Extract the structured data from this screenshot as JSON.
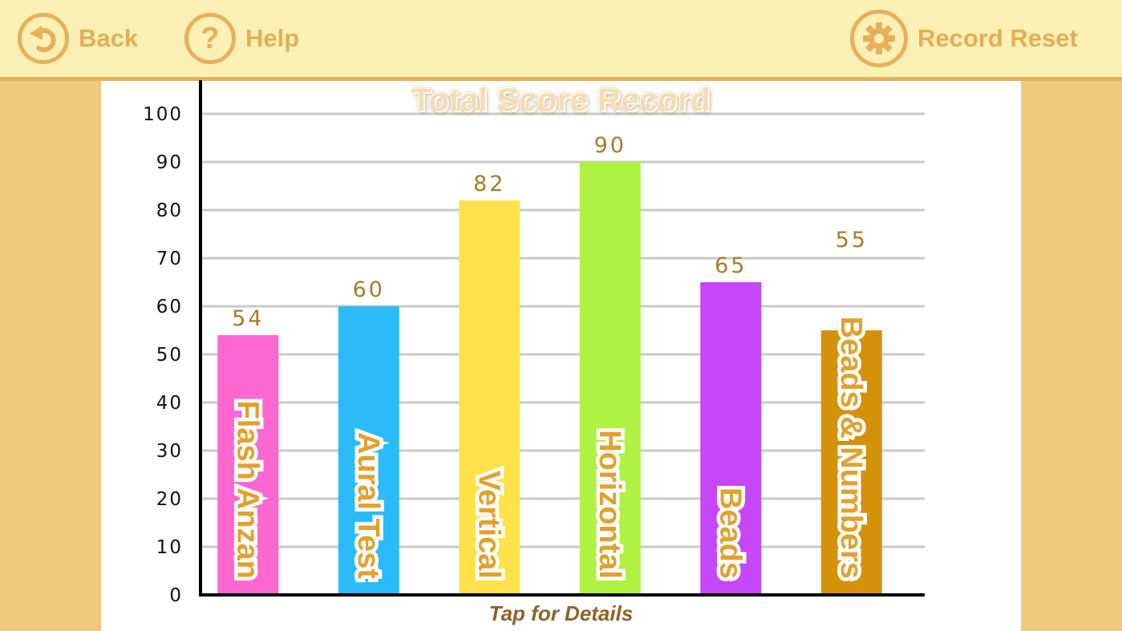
{
  "toolbar": {
    "back_label": "Back",
    "help_label": "Help",
    "reset_label": "Record Reset",
    "help_glyph": "?"
  },
  "icons": {
    "back": "back-arrow-icon",
    "help": "question-mark-icon",
    "reset": "gear-icon"
  },
  "colors": {
    "toolbar_bg": "#fdf0b4",
    "accent": "#e6b05c",
    "side_bg": "#f0c97f",
    "value_label": "#a77b2a"
  },
  "footer": {
    "label": "Tap for Details"
  },
  "chart_data": {
    "type": "bar",
    "title": "Total Score Record",
    "xlabel": "",
    "ylabel": "",
    "ylim": [
      0,
      100
    ],
    "yticks": [
      0,
      10,
      20,
      30,
      40,
      50,
      60,
      70,
      80,
      90,
      100
    ],
    "grid": true,
    "categories": [
      "Flash Anzan",
      "Aural Test",
      "Vertical",
      "Horizontal",
      "Beads",
      "Beads & Numbers"
    ],
    "values": [
      54,
      60,
      82,
      90,
      65,
      55
    ],
    "colors": [
      "#fc67d0",
      "#2bbbf9",
      "#ffe24a",
      "#aff241",
      "#c547f7",
      "#d4920b"
    ]
  }
}
